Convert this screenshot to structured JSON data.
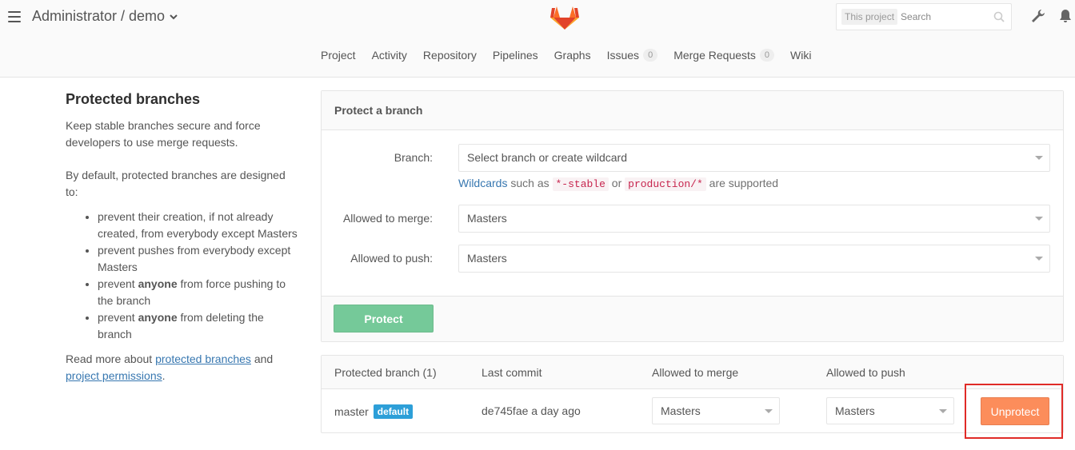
{
  "header": {
    "breadcrumb": "Administrator / demo",
    "search_scope": "This project",
    "search_placeholder": "Search"
  },
  "nav": {
    "items": [
      {
        "label": "Project"
      },
      {
        "label": "Activity"
      },
      {
        "label": "Repository"
      },
      {
        "label": "Pipelines"
      },
      {
        "label": "Graphs"
      },
      {
        "label": "Issues",
        "badge": "0"
      },
      {
        "label": "Merge Requests",
        "badge": "0"
      },
      {
        "label": "Wiki"
      }
    ]
  },
  "sidebar": {
    "title": "Protected branches",
    "intro": "Keep stable branches secure and force developers to use merge requests.",
    "default_text": "By default, protected branches are designed to:",
    "bullets": [
      {
        "pre": "prevent their creation, if not already created, from everybody except Masters",
        "bold": "",
        "post": ""
      },
      {
        "pre": "prevent pushes from everybody except Masters",
        "bold": "",
        "post": ""
      },
      {
        "pre": "prevent ",
        "bold": "anyone",
        "post": " from force pushing to the branch"
      },
      {
        "pre": "prevent ",
        "bold": "anyone",
        "post": " from deleting the branch"
      }
    ],
    "read_more_pre": "Read more about ",
    "link1": "protected branches",
    "read_more_mid": " and",
    "link2": "project permissions",
    "read_more_end": "."
  },
  "form": {
    "heading": "Protect a branch",
    "branch_label": "Branch:",
    "branch_placeholder": "Select branch or create wildcard",
    "help_link": "Wildcards",
    "help_such": " such as ",
    "help_code1": "*-stable",
    "help_or": " or ",
    "help_code2": "production/*",
    "help_end": " are supported",
    "merge_label": "Allowed to merge:",
    "merge_value": "Masters",
    "push_label": "Allowed to push:",
    "push_value": "Masters",
    "protect_button": "Protect"
  },
  "table": {
    "headers": [
      "Protected branch (1)",
      "Last commit",
      "Allowed to merge",
      "Allowed to push"
    ],
    "rows": [
      {
        "branch": "master",
        "badge": "default",
        "commit": "de745fae a day ago",
        "merge": "Masters",
        "push": "Masters",
        "action": "Unprotect"
      }
    ]
  },
  "colors": {
    "accent_link": "#3777b0",
    "protect_button": "#75c999",
    "unprotect_button": "#fc8d5b",
    "default_badge": "#2d9fd8",
    "highlight_box": "#e02b27"
  }
}
